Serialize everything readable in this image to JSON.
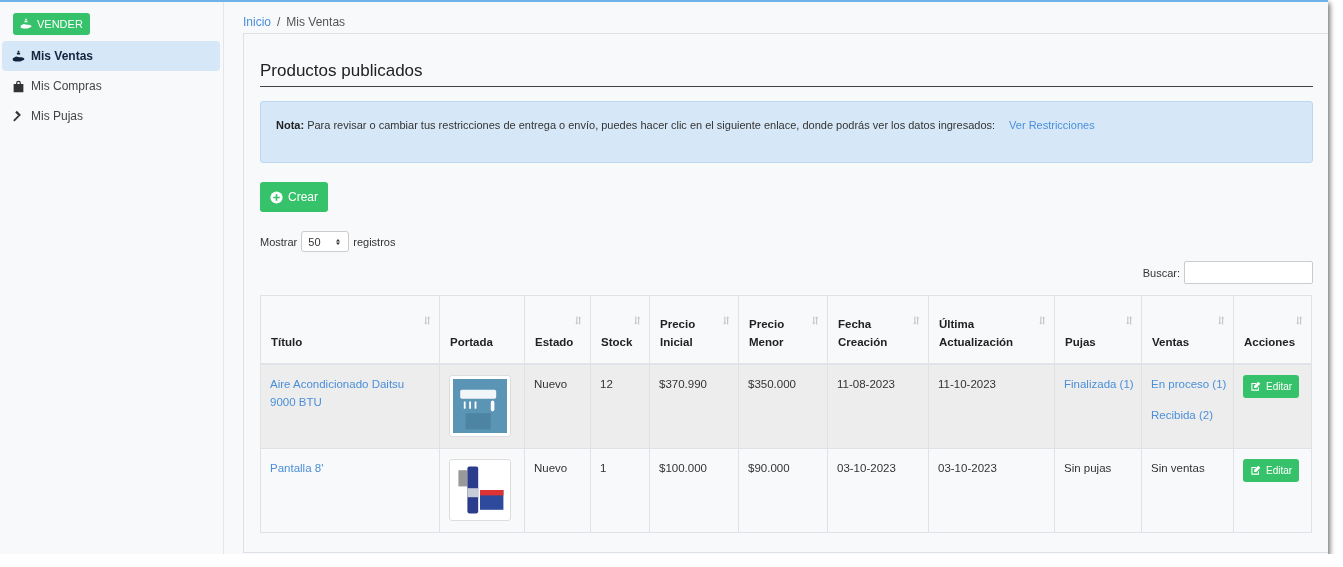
{
  "sidebar": {
    "sell_button": "VENDER",
    "items": [
      {
        "label": "Mis Ventas",
        "selected": true
      },
      {
        "label": "Mis Compras",
        "selected": false
      },
      {
        "label": "Mis Pujas",
        "selected": false
      }
    ]
  },
  "breadcrumb": {
    "separator": "/",
    "items": [
      {
        "label": "Inicio",
        "kind": "link"
      },
      {
        "label": "Mis Ventas",
        "kind": "current"
      }
    ]
  },
  "page_title": "Productos publicados",
  "note": {
    "label": "Nota:",
    "text": "Para revisar o cambiar tus restricciones de entrega o envío, puedes hacer clic en el siguiente enlace, donde podrás ver los datos ingresados:",
    "link": "Ver Restricciones"
  },
  "create_button": "Crear",
  "length_control": {
    "before": "Mostrar",
    "value": "50",
    "after": "registros"
  },
  "search": {
    "label": "Buscar:"
  },
  "table": {
    "columns": [
      {
        "label": "Título",
        "sortable": true
      },
      {
        "label": "Portada",
        "sortable": false
      },
      {
        "label": "Estado",
        "sortable": true
      },
      {
        "label": "Stock",
        "sortable": true
      },
      {
        "label": "Precio Inicial",
        "sortable": true
      },
      {
        "label": "Precio Menor",
        "sortable": true
      },
      {
        "label": "Fecha Creación",
        "sortable": true
      },
      {
        "label": "Última Actualización",
        "sortable": true
      },
      {
        "label": "Pujas",
        "sortable": true
      },
      {
        "label": "Ventas",
        "sortable": true
      },
      {
        "label": "Acciones",
        "sortable": true
      }
    ],
    "rows": [
      {
        "title": "Aire Acondicionado Daitsu 9000 BTU",
        "cover": {
          "kind": "picture"
        },
        "estado": "Nuevo",
        "stock": "12",
        "precio_inicial": "$370.990",
        "precio_menor": "$350.000",
        "fecha_creacion": "11-08-2023",
        "ultima_actualizacion": "11-10-2023",
        "pujas": {
          "text": "Finalizada (1)",
          "kind": "link"
        },
        "ventas": [
          {
            "text": "En proceso (1)",
            "kind": "link"
          },
          {
            "text": "Recibida (2)",
            "kind": "link"
          }
        ],
        "action": "Editar"
      },
      {
        "title": "Pantalla 8'",
        "cover": {
          "kind": "picture"
        },
        "estado": "Nuevo",
        "stock": "1",
        "precio_inicial": "$100.000",
        "precio_menor": "$90.000",
        "fecha_creacion": "03-10-2023",
        "ultima_actualizacion": "03-10-2023",
        "pujas": {
          "text": "Sin pujas",
          "kind": "text"
        },
        "ventas": [
          {
            "text": "Sin ventas",
            "kind": "text"
          }
        ],
        "action": "Editar"
      }
    ]
  }
}
